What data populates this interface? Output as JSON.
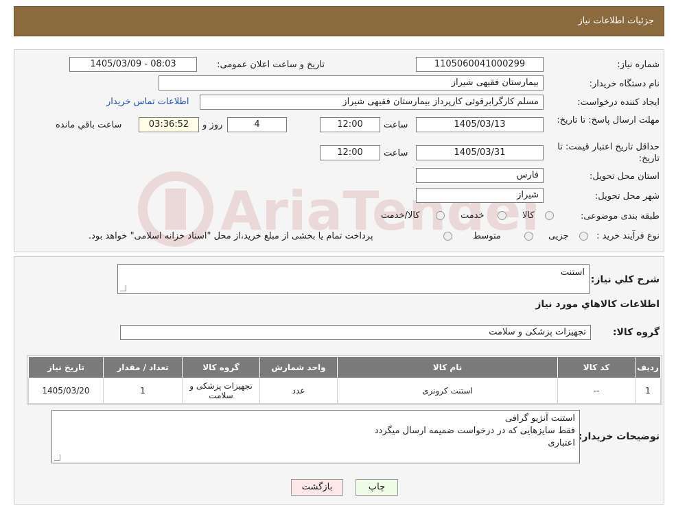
{
  "header": {
    "title": "جزئیات اطلاعات نیاز"
  },
  "form": {
    "need_number_label": "شماره نیاز:",
    "need_number": "1105060041000299",
    "announce_label": "تاریخ و ساعت اعلان عمومی:",
    "announce_value": "1405/03/09 - 08:03",
    "buyer_org_label": "نام دستگاه خریدار:",
    "buyer_org": "بیمارستان فقیهی شیراز",
    "creator_label": "ایجاد کننده درخواست:",
    "creator": "مسلم کارگرابرقوئی کارپرداز  بیمارستان فقیهی شیراز",
    "contact_link": "اطلاعات تماس خریدار",
    "reply_deadline_label": "مهلت ارسال پاسخ: تا تاریخ:",
    "reply_date": "1405/03/13",
    "time_label": "ساعت",
    "reply_time": "12:00",
    "days": "4",
    "days_label": "روز و",
    "remaining": "03:36:52",
    "remaining_label": "ساعت باقي مانده",
    "price_validity_label": "حداقل تاریخ اعتبار قیمت: تا تاریخ:",
    "validity_date": "1405/03/31",
    "validity_time": "12:00",
    "province_label": "استان محل تحویل:",
    "province": "فارس",
    "city_label": "شهر محل تحویل:",
    "city": "شیراز",
    "category_label": "طبقه بندی موضوعی:",
    "category_options": [
      "کالا",
      "خدمت",
      "کالا/خدمت"
    ],
    "process_label": "نوع فرآیند خرید :",
    "process_options": [
      "جزیی",
      "متوسط"
    ],
    "process_note": "پرداخت تمام یا بخشی از مبلغ خرید،از محل \"اسناد خزانه اسلامی\" خواهد بود."
  },
  "details": {
    "summary_label": "شرح كلي نياز:",
    "summary": "استنت",
    "goods_info_title": "اطلاعات كالاهاي مورد نياز",
    "goods_group_label": "گروه کالا:",
    "goods_group": "تجهیزات پزشکی و سلامت",
    "table": {
      "headers": [
        "رديف",
        "کد کالا",
        "نام کالا",
        "واحد شمارش",
        "گروه کالا",
        "تعداد / مقدار",
        "تاریخ نیاز"
      ],
      "rows": [
        [
          "1",
          "--",
          "استنت کرونری",
          "عدد",
          "تجهیزات پزشکی و سلامت",
          "1",
          "1405/03/20"
        ]
      ]
    },
    "buyer_notes_label": "توضیحات خریدار:",
    "buyer_notes": [
      "استنت آنژیو گرافی",
      "فقط سایزهایی که در درخواست ضمیمه ارسال میگردد",
      "اعتباری"
    ]
  },
  "buttons": {
    "print": "چاپ",
    "back": "بازگشت"
  },
  "watermark": {
    "text": "AriaTender.neT"
  },
  "colors": {
    "header": "#8b6a3e",
    "link": "#1f4fbf",
    "back_button": "#fde8e8",
    "print_button": "#eefbe6"
  }
}
